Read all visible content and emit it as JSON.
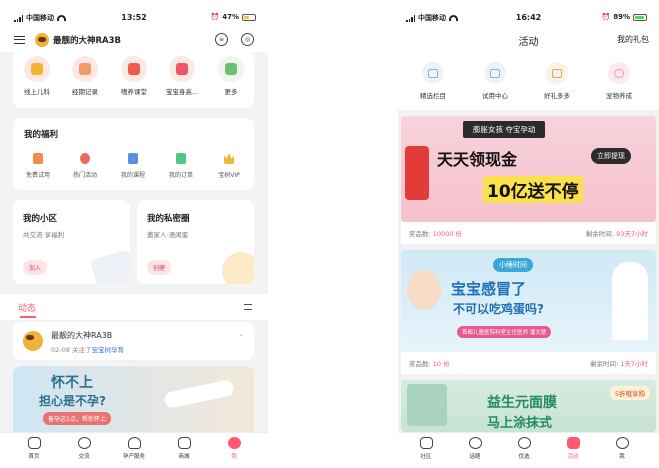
{
  "left": {
    "status": {
      "carrier": "中国移动",
      "time": "13:52",
      "battery": "47%",
      "battery_color": "#f4c430"
    },
    "header": {
      "username": "最靓的大神RA3B"
    },
    "tools": [
      {
        "label": "线上儿科",
        "color": "#f6b133"
      },
      {
        "label": "经期记录",
        "color": "#f39a6a"
      },
      {
        "label": "嗜养课堂",
        "color": "#ee5b4f"
      },
      {
        "label": "宝宝身高...",
        "color": "#f2556b"
      },
      {
        "label": "更多",
        "color": "#6fbf73"
      }
    ],
    "benefits": {
      "title": "我的福利",
      "items": [
        {
          "label": "免费试用",
          "color": "#f58b4e"
        },
        {
          "label": "热门活动",
          "color": "#ef6b5d"
        },
        {
          "label": "我的课程",
          "color": "#5d8fdc"
        },
        {
          "label": "我的订单",
          "color": "#53c48a"
        },
        {
          "label": "宝树VIP",
          "color": "#f2b632"
        }
      ]
    },
    "community": {
      "title": "我的小区",
      "subtitle": "共交流·享福利",
      "action": "加入"
    },
    "circle": {
      "title": "我的私密圈",
      "subtitle": "邀家人·语闺蜜",
      "action": "创建"
    },
    "feed": {
      "tab": "动态",
      "post": {
        "name": "最靓的大神RA3B",
        "date": "02-08",
        "text": "关注了",
        "link": "宝宝树孕育"
      },
      "banner_title": "怀不上",
      "banner_line2": "担心是不孕?",
      "banner_sub": "备孕这1点，帮你怀上"
    },
    "bottom_tabs": [
      "首页",
      "交流",
      "孕产服务",
      "商城",
      "我"
    ]
  },
  "right": {
    "status": {
      "carrier": "中国移动",
      "time": "16:42",
      "battery": "89%",
      "battery_color": "#4cd964"
    },
    "header": {
      "title": "活动",
      "gift": "我的礼包"
    },
    "nav": [
      "精选栏目",
      "试用中心",
      "好礼多多",
      "宠物养成"
    ],
    "activities": [
      {
        "tag": "膨胀女孩  夺宝孕动",
        "line1": "天天领现金",
        "line2": "10亿送不停",
        "button": "立即提现",
        "prize_label": "奖品数:",
        "prize": "10000 份",
        "time_label": "剩余时间:",
        "time": "93天7小时"
      },
      {
        "tag": "小睡时间",
        "line1": "宝宝感冒了",
        "line2": "不可以吃鸡蛋吗?",
        "sub": "首都儿童医院科室主任医师 潘文慧",
        "prize_label": "奖品数:",
        "prize": "10 份",
        "time_label": "剩余时间:",
        "time": "1天7小时"
      },
      {
        "line1": "益生元面膜",
        "line2": "马上涂抹式",
        "badge": "5折哦享购"
      }
    ],
    "bottom_tabs": [
      "社区",
      "话题",
      "优选",
      "活动",
      "我"
    ]
  }
}
